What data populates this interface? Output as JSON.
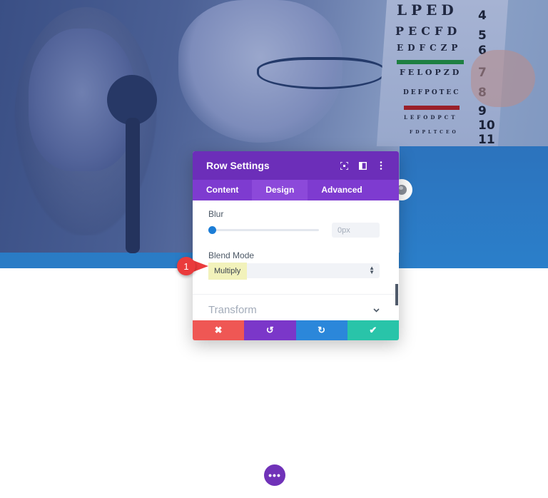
{
  "hero": {
    "eye_chart_rows": [
      "LPED",
      "PECFD",
      "EDFCZP",
      "FELOPZD",
      "DEFPOTEC",
      "LEFODPCT",
      "FDPLTCEO"
    ],
    "eye_chart_numbers": [
      "4",
      "5",
      "6",
      "7",
      "8",
      "9",
      "10",
      "11"
    ]
  },
  "modal": {
    "title": "Row Settings",
    "header_icons": [
      "focus-icon",
      "split-view-icon",
      "more-vertical-icon"
    ],
    "tabs": [
      {
        "label": "Content",
        "active": false
      },
      {
        "label": "Design",
        "active": true
      },
      {
        "label": "Advanced",
        "active": false
      }
    ],
    "blur": {
      "label": "Blur",
      "value": "0px",
      "slider_fraction": 0
    },
    "blend_mode": {
      "label": "Blend Mode",
      "value": "Multiply"
    },
    "section": {
      "label": "Transform"
    },
    "footer": {
      "cancel": "✖",
      "undo": "↺",
      "redo": "↻",
      "save": "✔"
    }
  },
  "callout": {
    "number": "1"
  },
  "more_button": {
    "label": "•••"
  },
  "colors": {
    "header_purple": "#6c2eb9",
    "tab_purple": "#7e3bd0",
    "cancel_red": "#ef5754",
    "undo_purple": "#7b37c9",
    "redo_blue": "#2b87da",
    "save_teal": "#29c4a9",
    "highlight_yellow": "#f2f2bb",
    "callout_red": "#ea3b3c"
  }
}
